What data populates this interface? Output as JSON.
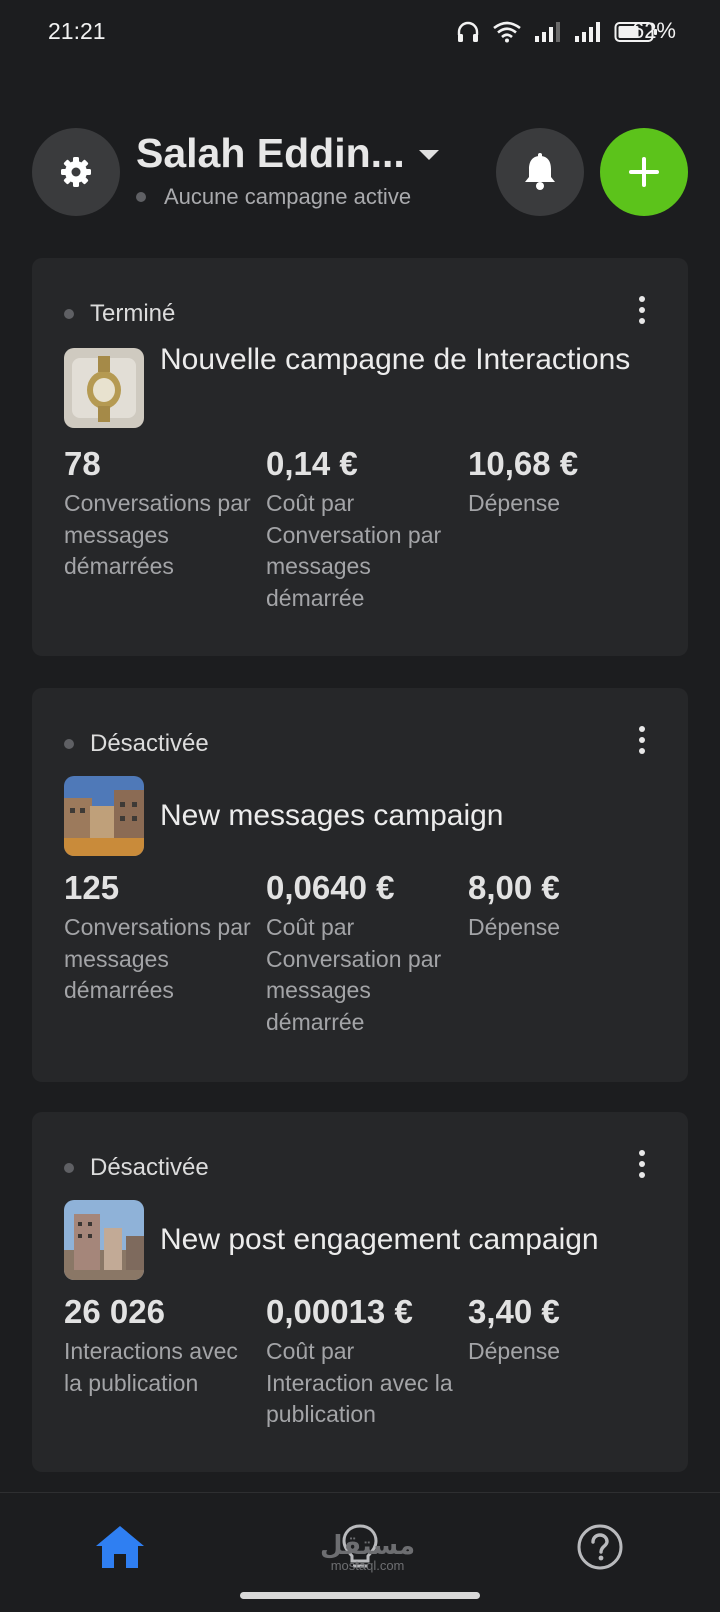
{
  "status_bar": {
    "time": "21:21",
    "battery_percent": "62%",
    "icons": [
      "headphones-icon",
      "wifi-icon",
      "signal-icon",
      "signal-icon",
      "battery-icon"
    ]
  },
  "header": {
    "account_name": "Salah Eddin...",
    "account_status": "Aucune campagne active",
    "settings_icon": "gear-icon",
    "notification_icon": "bell-icon",
    "add_icon": "plus-icon"
  },
  "colors": {
    "accent_green": "#5cc31b",
    "nav_active_blue": "#2f7ff2",
    "background": "#1c1d1f",
    "card": "#262729"
  },
  "campaigns": [
    {
      "status": "Terminé",
      "title": "Nouvelle campagne de Interactions",
      "metrics": [
        {
          "value": "78",
          "label": "Conversations par messages démarrées"
        },
        {
          "value": "0,14 €",
          "label": "Coût par Conversation par messages démarrée"
        },
        {
          "value": "10,68 €",
          "label": "Dépense"
        }
      ]
    },
    {
      "status": "Désactivée",
      "title": "New messages campaign",
      "metrics": [
        {
          "value": "125",
          "label": "Conversations par messages démarrées"
        },
        {
          "value": "0,0640 €",
          "label": "Coût par Conversation par messages démarrée"
        },
        {
          "value": "8,00 €",
          "label": "Dépense"
        }
      ]
    },
    {
      "status": "Désactivée",
      "title": "New post engagement campaign",
      "metrics": [
        {
          "value": "26 026",
          "label": "Interactions avec la publication"
        },
        {
          "value": "0,00013 €",
          "label": "Coût par Interaction avec la publication"
        },
        {
          "value": "3,40 €",
          "label": "Dépense"
        }
      ]
    }
  ],
  "bottom_nav": {
    "items": [
      "home-icon",
      "lightbulb-icon",
      "help-icon"
    ],
    "active": "home-icon"
  },
  "watermark": {
    "main": "مستقل",
    "sub": "mostaql.com"
  }
}
